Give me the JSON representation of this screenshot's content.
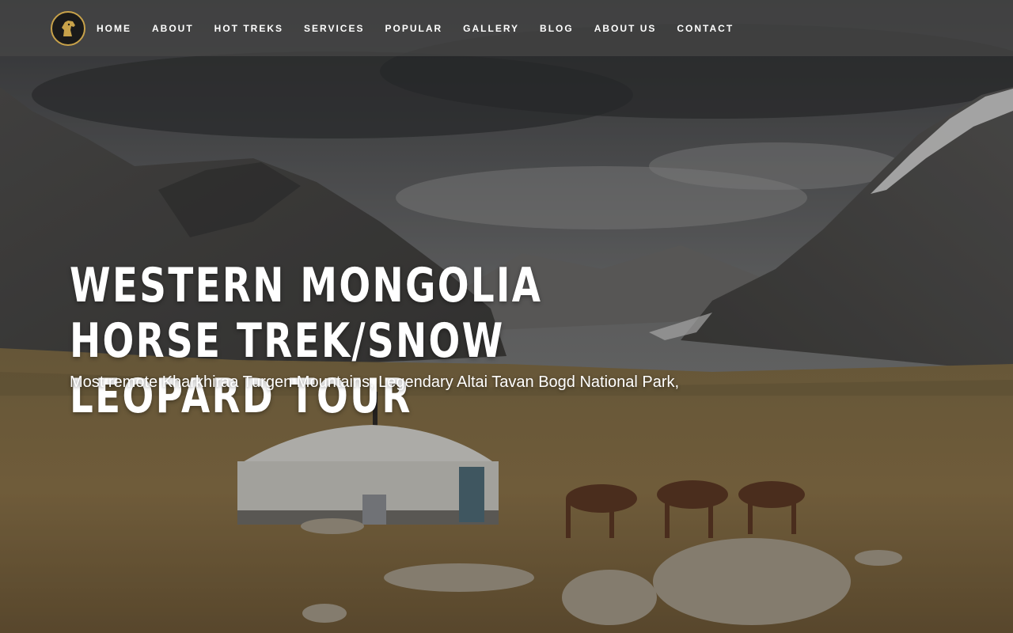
{
  "nav": {
    "logo_icon": "horse-head-logo-icon",
    "items": [
      {
        "label": "HOME"
      },
      {
        "label": "ABOUT"
      },
      {
        "label": "HOT TREKS"
      },
      {
        "label": "SERVICES"
      },
      {
        "label": "POPULAR"
      },
      {
        "label": "GALLERY"
      },
      {
        "label": "BLOG"
      },
      {
        "label": "ABOUT US"
      },
      {
        "label": "CONTACT"
      }
    ]
  },
  "hero": {
    "title": "WESTERN MONGOLIA HORSE TREK/SNOW LEOPARD TOUR",
    "subtitle": "Most remote Kharkhiraa Turgen Mountains, Legendary Altai Tavan Bogd National Park,"
  },
  "colors": {
    "nav_bg": "#464646",
    "logo_accent": "#c8a24a",
    "text": "#ffffff"
  }
}
